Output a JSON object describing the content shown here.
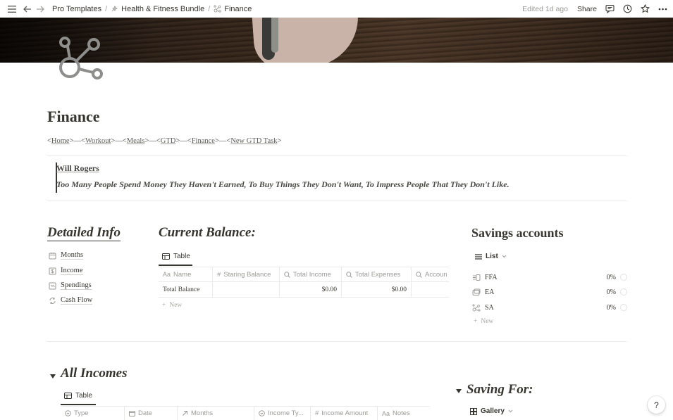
{
  "topbar": {
    "breadcrumbs": [
      "Pro Templates",
      "Health & Fitness Bundle",
      "Finance"
    ],
    "edited": "Edited 1d ago",
    "share_label": "Share"
  },
  "page": {
    "title": "Finance",
    "nav": {
      "open": "<",
      "close": ">",
      "sep": ">—<",
      "links": [
        "Home",
        "Workout",
        "Meals",
        "GTD",
        "Finance",
        "New GTD Task"
      ]
    },
    "quote": {
      "author": "Will Rogers",
      "text": "Too Many People Spend Money They Haven't Earned, To Buy Things They Don't Want, To Impress People That They Don't Like."
    }
  },
  "detailed_info": {
    "heading": "Detailed Info",
    "items": [
      "Months",
      "Income",
      "Spendings",
      "Cash Flow"
    ]
  },
  "current_balance": {
    "heading": "Current Balance:",
    "view_label": "Table",
    "columns": [
      "Name",
      "Staring Balance",
      "Total Income",
      "Total Expenses",
      "Accoun"
    ],
    "rows": [
      {
        "name": "Total Balance",
        "staring_balance": "",
        "total_income": "$0.00",
        "total_expenses": "$0.00",
        "account": ""
      }
    ],
    "new_label": "New"
  },
  "savings_accounts": {
    "heading": "Savings accounts",
    "view_label": "List",
    "items": [
      {
        "name": "FFA",
        "pct": "0%"
      },
      {
        "name": "EA",
        "pct": "0%"
      },
      {
        "name": "SA",
        "pct": "0%"
      }
    ],
    "new_label": "New"
  },
  "all_incomes": {
    "heading": "All Incomes",
    "view_label": "Table",
    "columns": [
      "Type",
      "Date",
      "Months",
      "Income Ty...",
      "Income Amount",
      "Notes"
    ]
  },
  "saving_for": {
    "heading": "Saving For:",
    "view_label": "Gallery"
  },
  "help_label": "?"
}
